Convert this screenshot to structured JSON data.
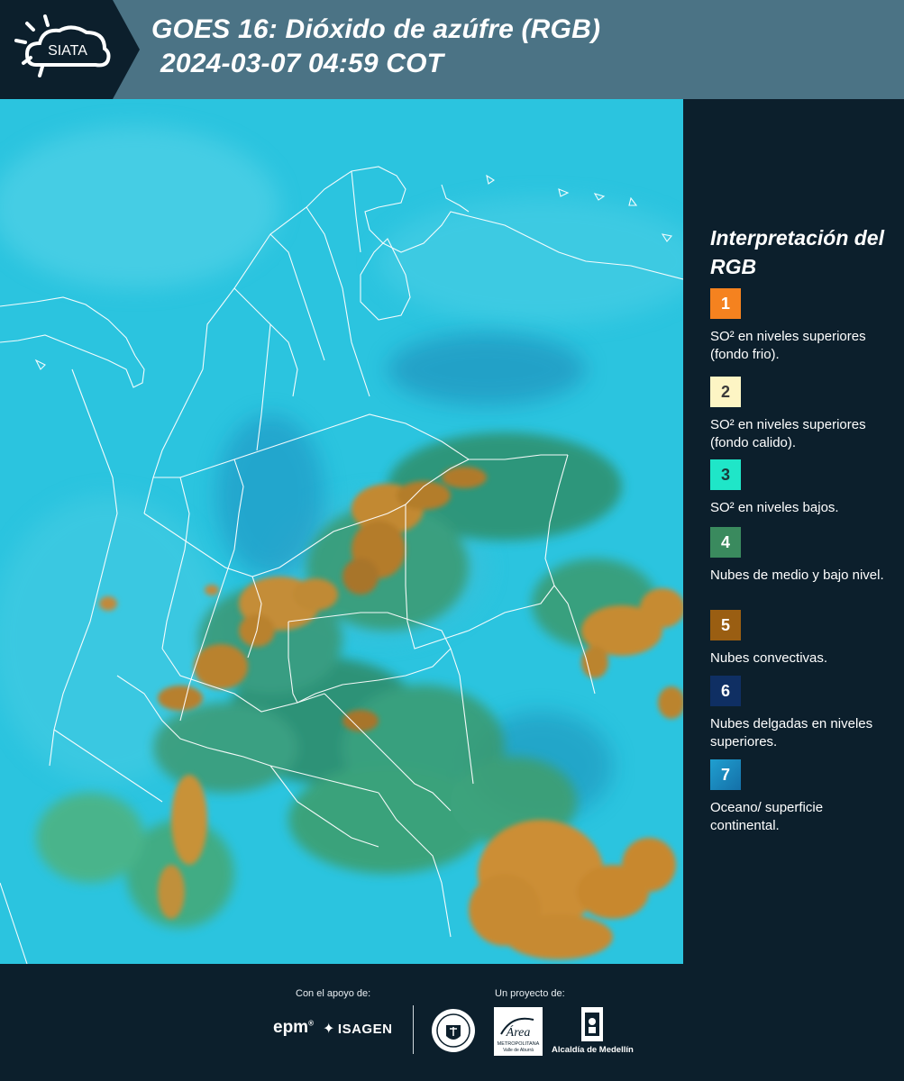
{
  "header": {
    "logo_text": "SIATA",
    "title_line1": "GOES 16: Dióxido de azúfre (RGB)",
    "title_line2": "2024-03-07 04:59 COT"
  },
  "legend": {
    "title": "Interpretación del RGB",
    "items": [
      {
        "number": "1",
        "color": "#f5821f",
        "text": "SO² en niveles superiores (fondo frio)."
      },
      {
        "number": "2",
        "color": "#fdf5c4",
        "text": "SO² en niveles superiores (fondo calido)."
      },
      {
        "number": "3",
        "color": "#1fe6c8",
        "text": "SO² en niveles bajos."
      },
      {
        "number": "4",
        "color": "#3a8a5e",
        "text": "Nubes de medio y bajo nivel."
      },
      {
        "number": "5",
        "color": "#9a5e12",
        "text": "Nubes convectivas."
      },
      {
        "number": "6",
        "color": "#0f2f63",
        "text": "Nubes delgadas en niveles superiores."
      },
      {
        "number": "7",
        "color": "#1b8fc0",
        "text": "Oceano/ superficie continental."
      }
    ]
  },
  "footer": {
    "support_label": "Con el apoyo de:",
    "project_label": "Un proyecto de:",
    "epm": "epm",
    "isagen": "ISAGEN",
    "area_name": "Área",
    "area_sub": "METROPOLITANA",
    "area_sub2": "Valle de Aburrá",
    "alcaldia": "Alcaldía de Medellín"
  },
  "map": {
    "ocean_color": "#29c3de",
    "convective_color": "#c9892e",
    "low_cloud_color": "#2f8f6a",
    "border_color": "#ffffff"
  }
}
